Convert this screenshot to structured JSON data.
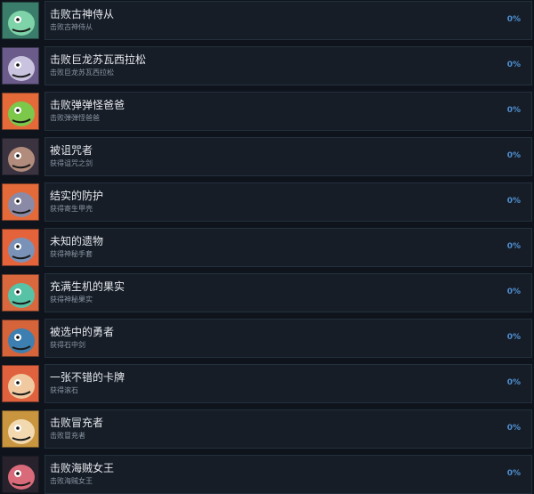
{
  "achievements": [
    {
      "title": "击败古神侍从",
      "desc": "击败古神侍从",
      "percent": "0%",
      "icon": "green-ghoul-icon",
      "bg": "#3a7d6a",
      "fg": "#7fd3a8"
    },
    {
      "title": "击败巨龙苏瓦西拉松",
      "desc": "击败巨龙苏瓦西拉松",
      "percent": "0%",
      "icon": "dragon-icon",
      "bg": "#6a5b8a",
      "fg": "#c9c3e0"
    },
    {
      "title": "击败弹弹怪爸爸",
      "desc": "击败弹弹怪爸爸",
      "percent": "0%",
      "icon": "slime-icon",
      "bg": "#e46a3a",
      "fg": "#7cc84a"
    },
    {
      "title": "被诅咒者",
      "desc": "获得诅咒之剑",
      "percent": "0%",
      "icon": "cursed-one-icon",
      "bg": "#3b3340",
      "fg": "#b18b7c"
    },
    {
      "title": "结实的防护",
      "desc": "获得寄生甲壳",
      "percent": "0%",
      "icon": "shell-armor-icon",
      "bg": "#e46a3a",
      "fg": "#8a8aa6"
    },
    {
      "title": "未知的遗物",
      "desc": "获得神秘手套",
      "percent": "0%",
      "icon": "mystery-glove-icon",
      "bg": "#e4633a",
      "fg": "#7a92b8"
    },
    {
      "title": "充满生机的果实",
      "desc": "获得神秘果实",
      "percent": "0%",
      "icon": "fruit-icon",
      "bg": "#d9683e",
      "fg": "#57c2a6"
    },
    {
      "title": "被选中的勇者",
      "desc": "获得石中剑",
      "percent": "0%",
      "icon": "chosen-hero-icon",
      "bg": "#d6643a",
      "fg": "#3d7fb0"
    },
    {
      "title": "一张不错的卡牌",
      "desc": "获得滚石",
      "percent": "0%",
      "icon": "card-icon",
      "bg": "#e0613d",
      "fg": "#f0c9a0"
    },
    {
      "title": "击败冒充者",
      "desc": "击败冒充者",
      "percent": "0%",
      "icon": "impostor-icon",
      "bg": "#c9953e",
      "fg": "#f2d9b0"
    },
    {
      "title": "击败海贼女王",
      "desc": "击败海贼女王",
      "percent": "0%",
      "icon": "pirate-queen-icon",
      "bg": "#27222c",
      "fg": "#d96a7a"
    }
  ]
}
